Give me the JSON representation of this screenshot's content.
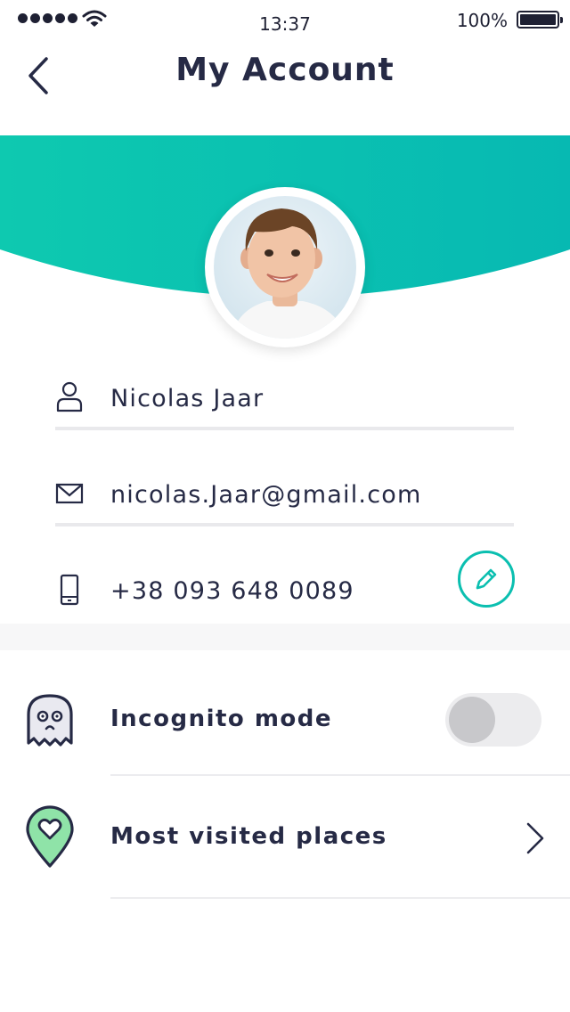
{
  "status_bar": {
    "time": "13:37",
    "battery": "100%"
  },
  "header": {
    "title": "My Account"
  },
  "profile": {
    "name": "Nicolas Jaar",
    "email": "nicolas.Jaar@gmail.com",
    "phone": "+38 093 648 0089"
  },
  "settings": {
    "incognito_label": "Incognito mode",
    "incognito_enabled": false,
    "places_label": "Most visited places"
  },
  "colors": {
    "accent": "#0bbfb0",
    "text": "#262a45",
    "pin_fill": "#8fe3a8"
  },
  "icons": {
    "back": "chevron-left-icon",
    "user": "user-icon",
    "email": "envelope-icon",
    "phone": "phone-icon",
    "edit": "pencil-icon",
    "incognito": "ghost-icon",
    "places": "heart-pin-icon",
    "places_arrow": "chevron-right-icon"
  }
}
